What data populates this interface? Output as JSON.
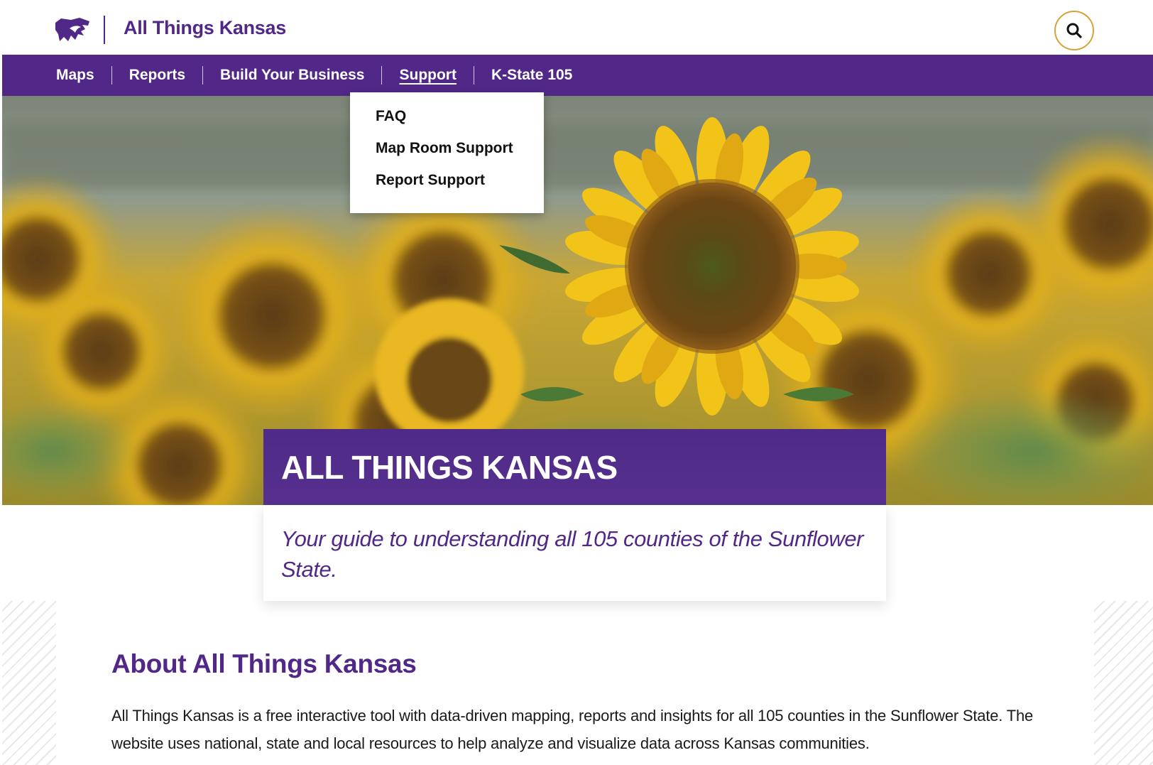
{
  "header": {
    "site_title": "All Things Kansas",
    "logo_icon": "powercat-logo-icon",
    "search_icon": "search-icon"
  },
  "nav": {
    "items": [
      {
        "label": "Maps"
      },
      {
        "label": "Reports"
      },
      {
        "label": "Build Your Business"
      },
      {
        "label": "Support",
        "active": true
      },
      {
        "label": "K-State 105"
      }
    ]
  },
  "support_dropdown": {
    "items": [
      {
        "label": "FAQ"
      },
      {
        "label": "Map Room Support"
      },
      {
        "label": "Report Support"
      }
    ]
  },
  "hero": {
    "title": "ALL THINGS KANSAS",
    "tagline": "Your guide to understanding all 105 counties of the Sunflower State."
  },
  "about": {
    "title": "About All Things Kansas",
    "text": "All Things Kansas is a free interactive tool with data-driven mapping, reports and insights for all 105 counties in the Sunflower State. The website uses national, state and local resources to help analyze and visualize data across Kansas communities."
  },
  "colors": {
    "brand_purple": "#512888",
    "search_ring": "#d4a43a",
    "sunflower_yellow": "#f2c318"
  }
}
